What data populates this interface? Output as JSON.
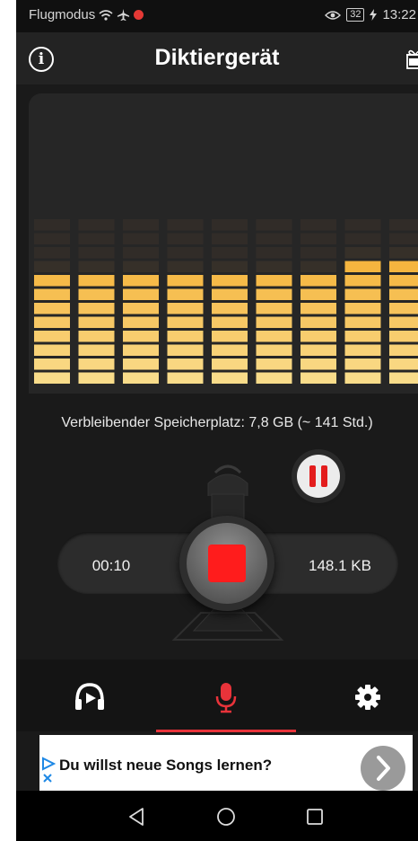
{
  "status_bar": {
    "carrier": "Flugmodus",
    "battery": "32",
    "time": "13:22"
  },
  "header": {
    "title": "Diktiergerät",
    "info_icon": "info-circle-icon",
    "gift_icon": "gift-ad-icon"
  },
  "level_meter": {
    "bars": [
      0.82,
      0.83,
      0.83,
      0.83,
      0.83,
      0.83,
      0.84,
      0.86,
      0.87
    ],
    "colors": {
      "fill_top": "#f4a623",
      "fill_bottom": "#f9dc8a",
      "empty": "#3a322a"
    }
  },
  "storage_text": "Verbleibender Speicherplatz: 7,8 GB (~ 141 Std.)",
  "recorder": {
    "elapsed": "00:10",
    "file_size": "148.1 KB",
    "pause_icon": "pause-icon",
    "record_icon": "stop-record-icon"
  },
  "tabs": [
    {
      "name": "playback",
      "icon": "headphones-play-icon"
    },
    {
      "name": "record",
      "icon": "microphone-icon",
      "active": true
    },
    {
      "name": "settings",
      "icon": "gear-icon"
    }
  ],
  "ad": {
    "text": "Du willst neue Songs lernen?",
    "icon": "chevron-right-icon"
  },
  "nav": [
    "back-icon",
    "home-icon",
    "recents-icon"
  ],
  "colors": {
    "accent": "#e8333a",
    "record": "#ff1c1c"
  }
}
